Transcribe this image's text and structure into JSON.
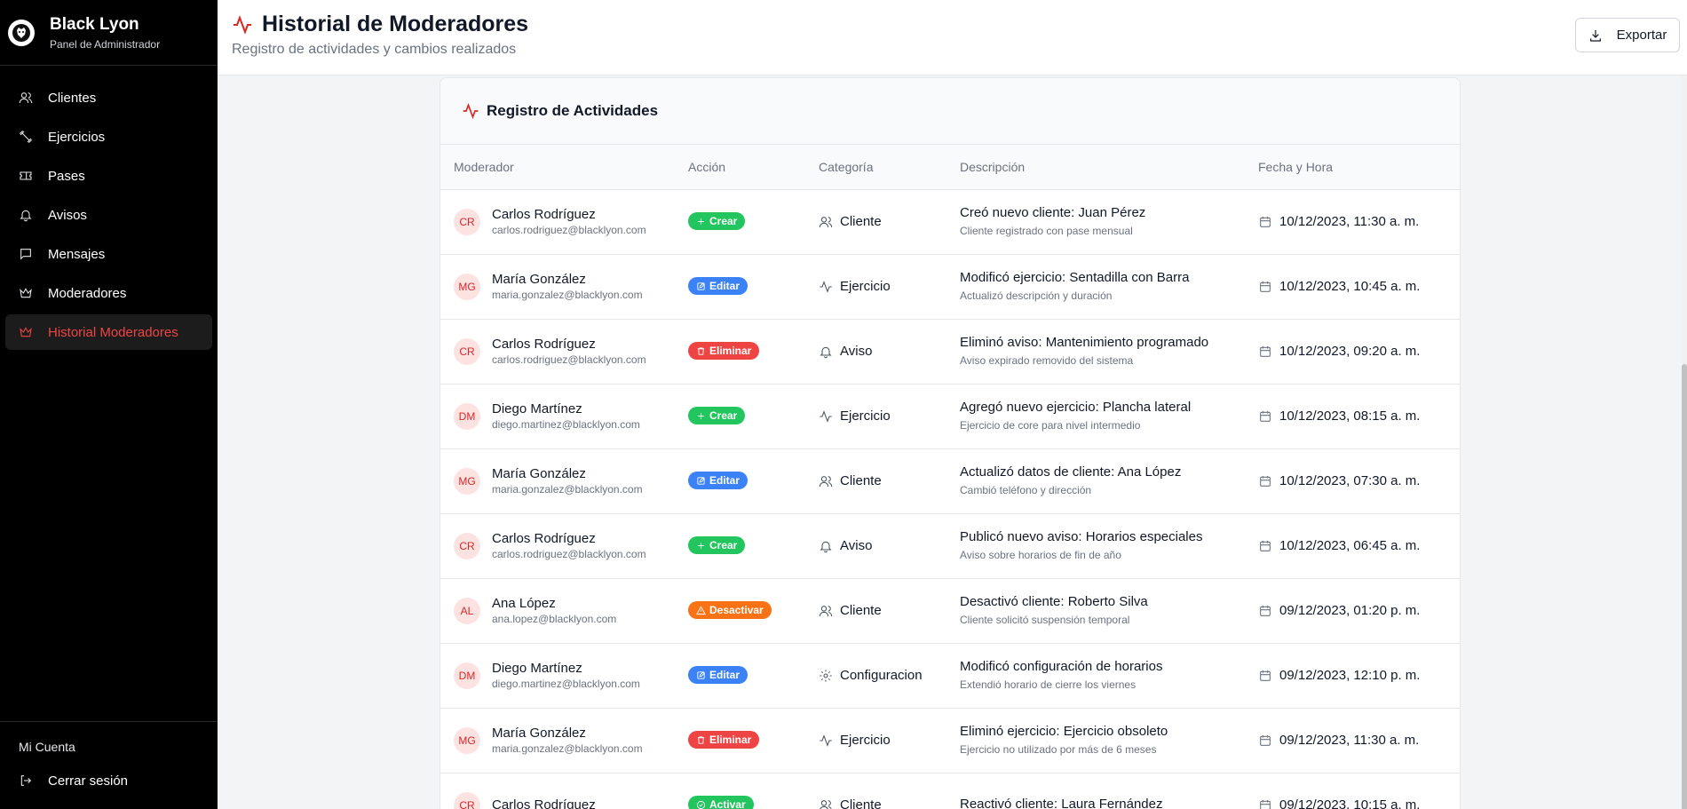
{
  "brand": {
    "name": "Black Lyon",
    "subtitle": "Panel de Administrador"
  },
  "nav": [
    {
      "label": "Clientes",
      "icon": "users-icon"
    },
    {
      "label": "Ejercicios",
      "icon": "dumbbell-icon"
    },
    {
      "label": "Pases",
      "icon": "ticket-icon"
    },
    {
      "label": "Avisos",
      "icon": "bell-icon"
    },
    {
      "label": "Mensajes",
      "icon": "message-icon"
    },
    {
      "label": "Moderadores",
      "icon": "crown-icon"
    },
    {
      "label": "Historial Moderadores",
      "icon": "crown-icon",
      "active": true
    }
  ],
  "account": {
    "label": "Mi Cuenta",
    "logout": "Cerrar sesión"
  },
  "header": {
    "title": "Historial de Moderadores",
    "subtitle": "Registro de actividades y cambios realizados",
    "export_label": "Exportar"
  },
  "card": {
    "title": "Registro de Actividades"
  },
  "table": {
    "columns": [
      "Moderador",
      "Acción",
      "Categoría",
      "Descripción",
      "Fecha y Hora"
    ],
    "rows": [
      {
        "initials": "CR",
        "name": "Carlos Rodríguez",
        "email": "carlos.rodriguez@blacklyon.com",
        "action": "Crear",
        "category": "Cliente",
        "desc": "Creó nuevo cliente: Juan Pérez",
        "detail": "Cliente registrado con pase mensual",
        "date": "10/12/2023, 11:30 a. m."
      },
      {
        "initials": "MG",
        "name": "María González",
        "email": "maria.gonzalez@blacklyon.com",
        "action": "Editar",
        "category": "Ejercicio",
        "desc": "Modificó ejercicio: Sentadilla con Barra",
        "detail": "Actualizó descripción y duración",
        "date": "10/12/2023, 10:45 a. m."
      },
      {
        "initials": "CR",
        "name": "Carlos Rodríguez",
        "email": "carlos.rodriguez@blacklyon.com",
        "action": "Eliminar",
        "category": "Aviso",
        "desc": "Eliminó aviso: Mantenimiento programado",
        "detail": "Aviso expirado removido del sistema",
        "date": "10/12/2023, 09:20 a. m."
      },
      {
        "initials": "DM",
        "name": "Diego Martínez",
        "email": "diego.martinez@blacklyon.com",
        "action": "Crear",
        "category": "Ejercicio",
        "desc": "Agregó nuevo ejercicio: Plancha lateral",
        "detail": "Ejercicio de core para nivel intermedio",
        "date": "10/12/2023, 08:15 a. m."
      },
      {
        "initials": "MG",
        "name": "María González",
        "email": "maria.gonzalez@blacklyon.com",
        "action": "Editar",
        "category": "Cliente",
        "desc": "Actualizó datos de cliente: Ana López",
        "detail": "Cambió teléfono y dirección",
        "date": "10/12/2023, 07:30 a. m."
      },
      {
        "initials": "CR",
        "name": "Carlos Rodríguez",
        "email": "carlos.rodriguez@blacklyon.com",
        "action": "Crear",
        "category": "Aviso",
        "desc": "Publicó nuevo aviso: Horarios especiales",
        "detail": "Aviso sobre horarios de fin de año",
        "date": "10/12/2023, 06:45 a. m."
      },
      {
        "initials": "AL",
        "name": "Ana López",
        "email": "ana.lopez@blacklyon.com",
        "action": "Desactivar",
        "category": "Cliente",
        "desc": "Desactivó cliente: Roberto Silva",
        "detail": "Cliente solicitó suspensión temporal",
        "date": "09/12/2023, 01:20 p. m."
      },
      {
        "initials": "DM",
        "name": "Diego Martínez",
        "email": "diego.martinez@blacklyon.com",
        "action": "Editar",
        "category": "Configuracion",
        "desc": "Modificó configuración de horarios",
        "detail": "Extendió horario de cierre los viernes",
        "date": "09/12/2023, 12:10 p. m."
      },
      {
        "initials": "MG",
        "name": "María González",
        "email": "maria.gonzalez@blacklyon.com",
        "action": "Eliminar",
        "category": "Ejercicio",
        "desc": "Eliminó ejercicio: Ejercicio obsoleto",
        "detail": "Ejercicio no utilizado por más de 6 meses",
        "date": "09/12/2023, 11:30 a. m."
      },
      {
        "initials": "CR",
        "name": "Carlos Rodríguez",
        "email": "",
        "action": "Activar",
        "category": "Cliente",
        "desc": "Reactivó cliente: Laura Fernández",
        "detail": "",
        "date": "09/12/2023, 10:15 a. m."
      }
    ]
  },
  "action_colors": {
    "Crear": "#22c55e",
    "Editar": "#3b82f6",
    "Eliminar": "#ef4444",
    "Desactivar": "#f97316",
    "Activar": "#22c55e"
  },
  "accent_color": "#dc2626"
}
